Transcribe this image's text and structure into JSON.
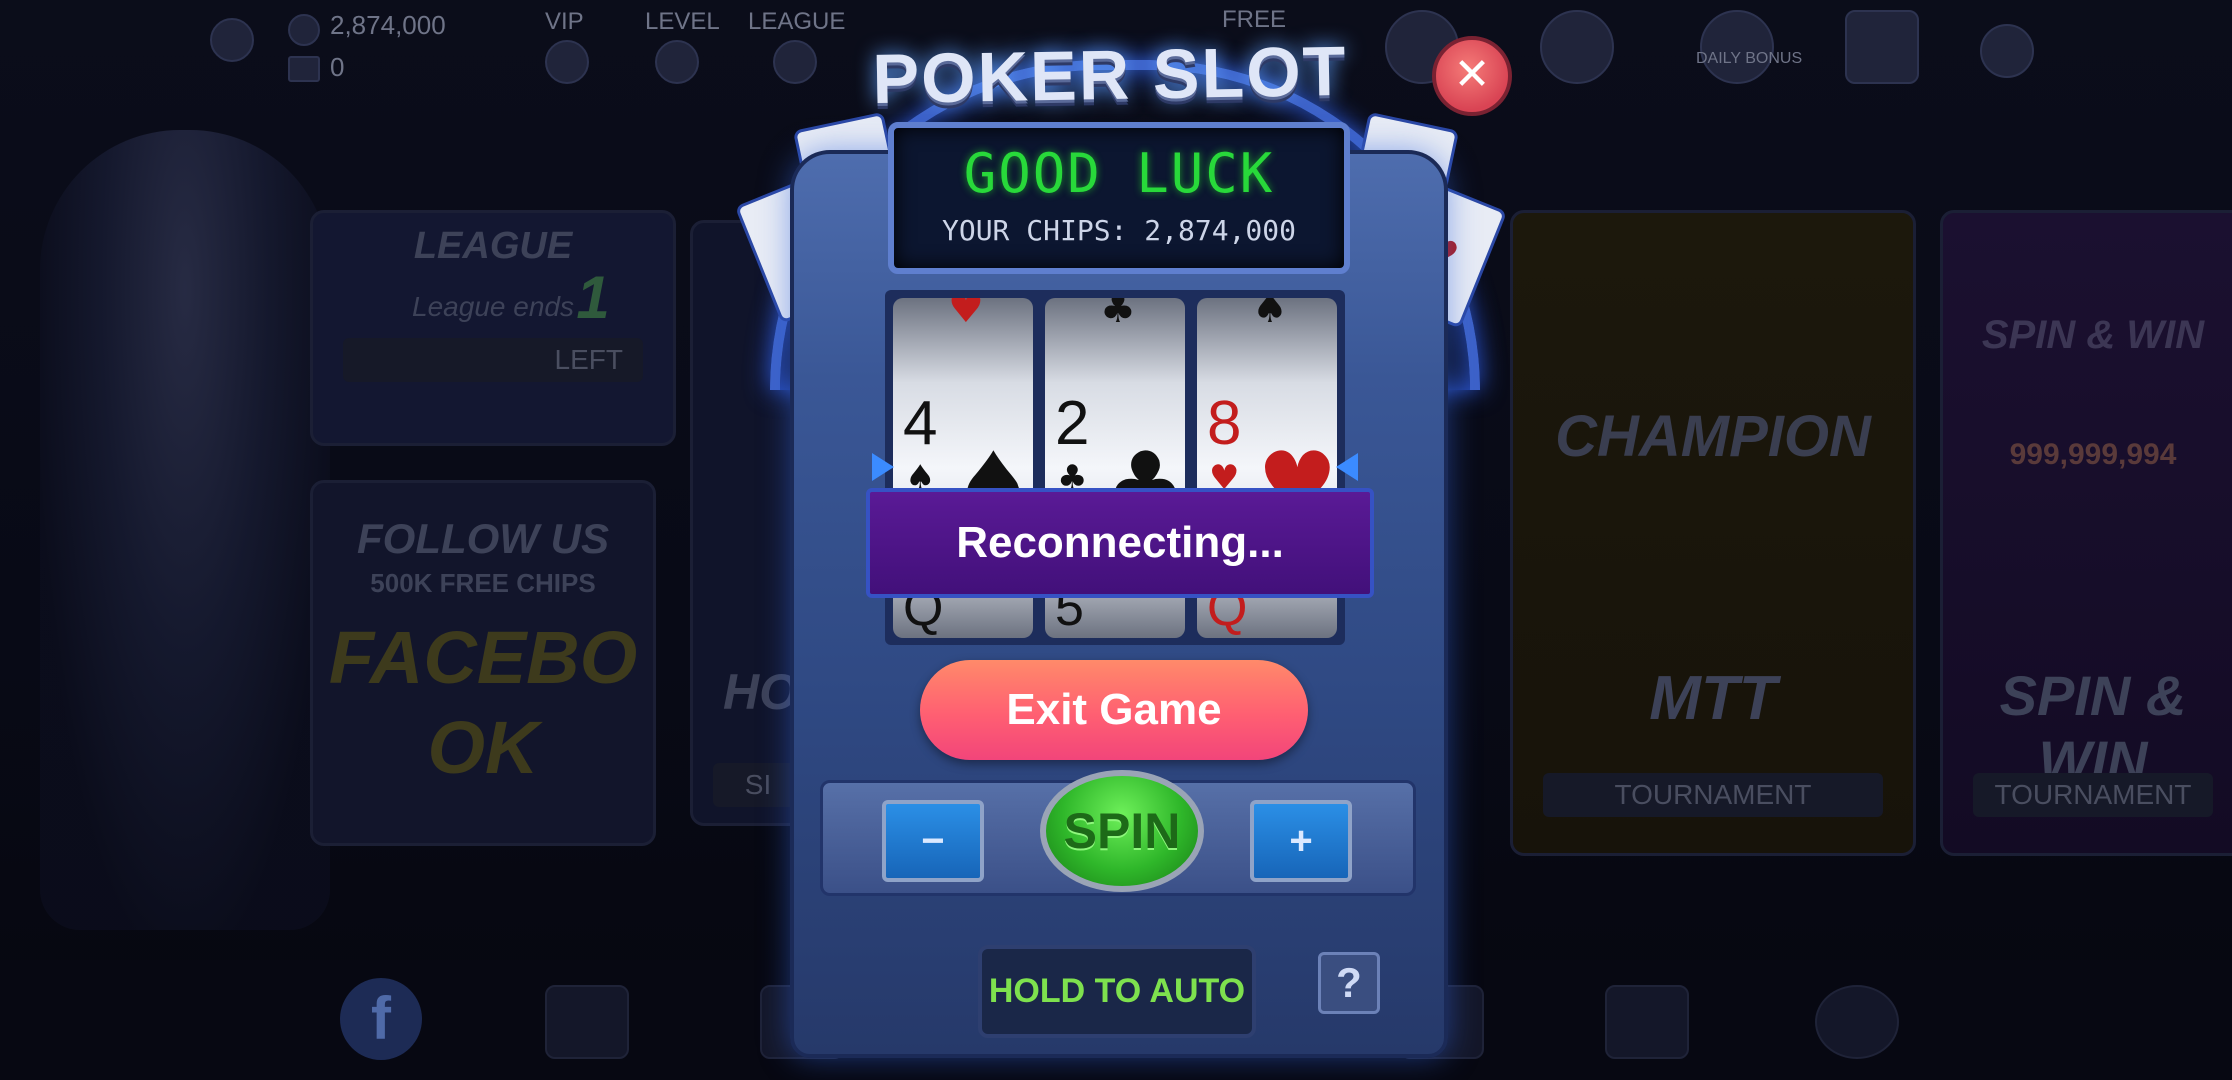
{
  "hud": {
    "chips": "2,874,000",
    "tickets": "0",
    "vip_label": "VIP",
    "level_label": "LEVEL",
    "league_label": "LEAGUE",
    "free_label": "FREE",
    "daily_bonus_label": "DAILY BONUS"
  },
  "lobby": {
    "league_card": {
      "title": "LEAGUE",
      "subtitle": "League ends",
      "left": "LEFT",
      "badge": "1"
    },
    "follow_card": {
      "title": "FOLLOW US",
      "subtitle": "500K FREE CHIPS",
      "brand": "FACEBOOK"
    },
    "mtt_card": {
      "title": "MTT",
      "sub": "TOURNAMENT",
      "badge": "CHAMPION"
    },
    "spin_card": {
      "title": "SPIN & WIN",
      "sub": "TOURNAMENT",
      "prize": "999,999,994",
      "badge": "SPIN & WIN"
    },
    "partial_card": {
      "title": "HO",
      "sub": "SI"
    }
  },
  "slot": {
    "title": "POKER SLOT",
    "display_main": "GOOD LUCK",
    "display_sub": "YOUR CHIPS: 2,874,000",
    "reels": [
      {
        "rank": "4",
        "suit": "♠",
        "color": "#111111",
        "top_pip": "♥",
        "top_color": "#c31d1d",
        "next_rank": "Q",
        "next_color": "#111111"
      },
      {
        "rank": "2",
        "suit": "♣",
        "color": "#111111",
        "top_pip": "♣",
        "top_color": "#111111",
        "next_rank": "5",
        "next_color": "#111111"
      },
      {
        "rank": "8",
        "suit": "♥",
        "color": "#c31d1d",
        "top_pip": "♠",
        "top_color": "#111111",
        "next_rank": "Q",
        "next_color": "#c31d1d"
      }
    ],
    "reconnecting": "Reconnecting...",
    "exit_label": "Exit Game",
    "spin_label": "SPIN",
    "minus_label": "−",
    "plus_label": "+",
    "auto_label": "HOLD TO AUTO",
    "help_label": "?",
    "close_label": "✕"
  },
  "colors": {
    "accent_green": "#28d93a",
    "reconnect_bg": "#4a138a",
    "exit_bg": "#ff6a72",
    "cabinet": "#3a5796"
  }
}
